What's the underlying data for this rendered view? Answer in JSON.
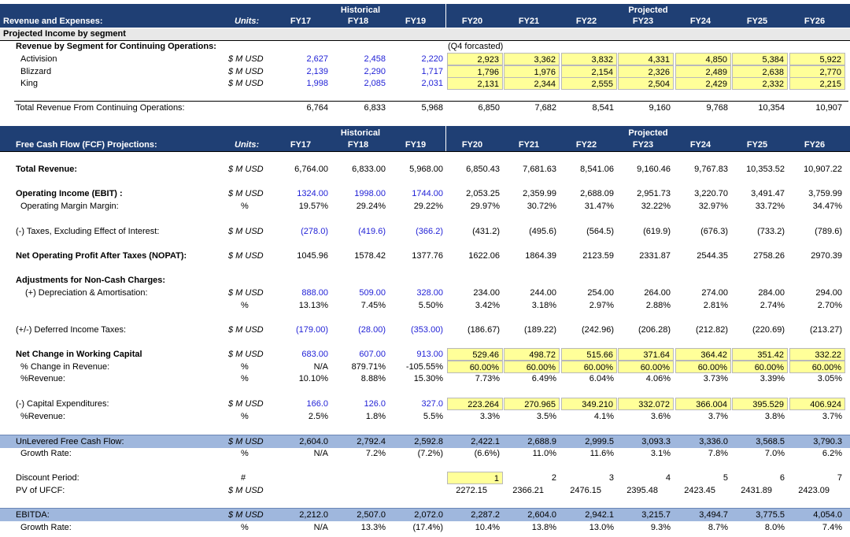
{
  "years": [
    "FY17",
    "FY18",
    "FY19",
    "FY20",
    "FY21",
    "FY22",
    "FY23",
    "FY24",
    "FY25",
    "FY26"
  ],
  "group_historical": "Historical",
  "group_projected": "Projected",
  "units_label": "Units:",
  "section1": {
    "header_title": "Revenue and Expenses:",
    "sub_title": "Projected Income by segment",
    "segment_title": "Revenue by Segment for Continuing Operations:",
    "note": "(Q4 forcasted)",
    "rows": [
      {
        "label": "Activision",
        "unit": "$ M USD",
        "values": [
          "2,627",
          "2,458",
          "2,220",
          "2,923",
          "3,362",
          "3,832",
          "4,331",
          "4,850",
          "5,384",
          "5,922"
        ]
      },
      {
        "label": "Blizzard",
        "unit": "$ M USD",
        "values": [
          "2,139",
          "2,290",
          "1,717",
          "1,796",
          "1,976",
          "2,154",
          "2,326",
          "2,489",
          "2,638",
          "2,770"
        ]
      },
      {
        "label": "King",
        "unit": "$ M USD",
        "values": [
          "1,998",
          "2,085",
          "2,031",
          "2,131",
          "2,344",
          "2,555",
          "2,504",
          "2,429",
          "2,332",
          "2,215"
        ]
      }
    ],
    "total": {
      "label": "Total Revenue From Continuing Operations:",
      "values": [
        "6,764",
        "6,833",
        "5,968",
        "6,850",
        "7,682",
        "8,541",
        "9,160",
        "9,768",
        "10,354",
        "10,907"
      ]
    }
  },
  "section2": {
    "header_title": "Free Cash Flow (FCF) Projections:",
    "total_revenue": {
      "label": "Total Revenue:",
      "unit": "$ M USD",
      "values": [
        "6,764.00",
        "6,833.00",
        "5,968.00",
        "6,850.43",
        "7,681.63",
        "8,541.06",
        "9,160.46",
        "9,767.83",
        "10,353.52",
        "10,907.22"
      ]
    },
    "ebit": {
      "label": "Operating Income (EBIT) :",
      "unit": "$ M USD",
      "values": [
        "1324.00",
        "1998.00",
        "1744.00",
        "2,053.25",
        "2,359.99",
        "2,688.09",
        "2,951.73",
        "3,220.70",
        "3,491.47",
        "3,759.99"
      ]
    },
    "op_margin": {
      "label": "Operating Margin  Margin:",
      "unit": "%",
      "values": [
        "19.57%",
        "29.24%",
        "29.22%",
        "29.97%",
        "30.72%",
        "31.47%",
        "32.22%",
        "32.97%",
        "33.72%",
        "34.47%"
      ]
    },
    "taxes": {
      "label": "(-) Taxes, Excluding Effect of Interest:",
      "unit": "$ M USD",
      "values": [
        "(278.0)",
        "(419.6)",
        "(366.2)",
        "(431.2)",
        "(495.6)",
        "(564.5)",
        "(619.9)",
        "(676.3)",
        "(733.2)",
        "(789.6)"
      ]
    },
    "nopat": {
      "label": "Net Operating Profit After Taxes (NOPAT):",
      "unit": "$ M USD",
      "values": [
        "1045.96",
        "1578.42",
        "1377.76",
        "1622.06",
        "1864.39",
        "2123.59",
        "2331.87",
        "2544.35",
        "2758.26",
        "2970.39"
      ]
    },
    "adj_title": "Adjustments for Non-Cash Charges:",
    "da": {
      "label": "(+) Depreciation & Amortisation:",
      "unit": "$ M USD",
      "values": [
        "888.00",
        "509.00",
        "328.00",
        "234.00",
        "244.00",
        "254.00",
        "264.00",
        "274.00",
        "284.00",
        "294.00"
      ]
    },
    "da_pct": {
      "unit": "%",
      "values": [
        "13.13%",
        "7.45%",
        "5.50%",
        "3.42%",
        "3.18%",
        "2.97%",
        "2.88%",
        "2.81%",
        "2.74%",
        "2.70%"
      ]
    },
    "deferred": {
      "label": "(+/-) Deferred Income Taxes:",
      "unit": "$ M USD",
      "values": [
        "(179.00)",
        "(28.00)",
        "(353.00)",
        "(186.67)",
        "(189.22)",
        "(242.96)",
        "(206.28)",
        "(212.82)",
        "(220.69)",
        "(213.27)"
      ]
    },
    "nwc": {
      "label": "Net Change in Working Capital",
      "unit": "$ M USD",
      "values": [
        "683.00",
        "607.00",
        "913.00",
        "529.46",
        "498.72",
        "515.66",
        "371.64",
        "364.42",
        "351.42",
        "332.22"
      ]
    },
    "nwc_change": {
      "label": "% Change in Revenue:",
      "unit": "%",
      "values": [
        "N/A",
        "879.71%",
        "-105.55%",
        "60.00%",
        "60.00%",
        "60.00%",
        "60.00%",
        "60.00%",
        "60.00%",
        "60.00%"
      ]
    },
    "nwc_rev": {
      "label": "%Revenue:",
      "unit": "%",
      "values": [
        "10.10%",
        "8.88%",
        "15.30%",
        "7.73%",
        "6.49%",
        "6.04%",
        "4.06%",
        "3.73%",
        "3.39%",
        "3.05%"
      ]
    },
    "capex": {
      "label": "(-) Capital Expenditures:",
      "unit": "$ M USD",
      "values": [
        "166.0",
        "126.0",
        "327.0",
        "223.264",
        "270.965",
        "349.210",
        "332.072",
        "366.004",
        "395.529",
        "406.924"
      ]
    },
    "capex_rev": {
      "label": "%Revenue:",
      "unit": "%",
      "values": [
        "2.5%",
        "1.8%",
        "5.5%",
        "3.3%",
        "3.5%",
        "4.1%",
        "3.6%",
        "3.7%",
        "3.8%",
        "3.7%"
      ]
    },
    "ufcf": {
      "label": "UnLevered Free Cash Flow:",
      "unit": "$ M USD",
      "values": [
        "2,604.0",
        "2,792.4",
        "2,592.8",
        "2,422.1",
        "2,688.9",
        "2,999.5",
        "3,093.3",
        "3,336.0",
        "3,568.5",
        "3,790.3"
      ]
    },
    "ufcf_growth": {
      "label": "Growth Rate:",
      "unit": "%",
      "values": [
        "N/A",
        "7.2%",
        "(7.2%)",
        "(6.6%)",
        "11.0%",
        "11.6%",
        "3.1%",
        "7.8%",
        "7.0%",
        "6.2%"
      ]
    },
    "discount": {
      "label": "Discount Period:",
      "unit": "#",
      "values": [
        "1",
        "2",
        "3",
        "4",
        "5",
        "6",
        "7"
      ]
    },
    "pv": {
      "label": "PV of UFCF:",
      "unit": "$ M USD",
      "values": [
        "2272.15",
        "2366.21",
        "2476.15",
        "2395.48",
        "2423.45",
        "2431.89",
        "2423.09"
      ]
    },
    "ebitda": {
      "label": "EBITDA:",
      "unit": "$ M USD",
      "values": [
        "2,212.0",
        "2,507.0",
        "2,072.0",
        "2,287.2",
        "2,604.0",
        "2,942.1",
        "3,215.7",
        "3,494.7",
        "3,775.5",
        "4,054.0"
      ]
    },
    "ebitda_growth": {
      "label": "Growth Rate:",
      "unit": "%",
      "values": [
        "N/A",
        "13.3%",
        "(17.4%)",
        "10.4%",
        "13.8%",
        "13.0%",
        "9.3%",
        "8.7%",
        "8.0%",
        "7.4%"
      ]
    }
  }
}
